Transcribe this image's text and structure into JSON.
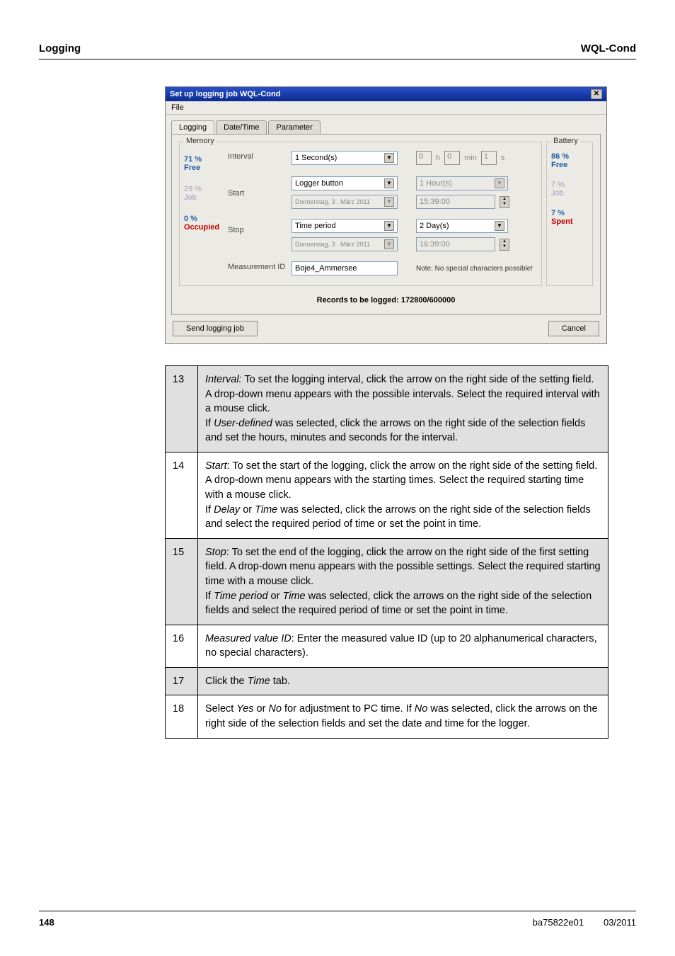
{
  "header": {
    "left": "Logging",
    "right": "WQL-Cond"
  },
  "dialog": {
    "title": "Set up logging job WQL-Cond",
    "menu": {
      "file": "File"
    },
    "tabs": {
      "logging": "Logging",
      "datetime": "Date/Time",
      "parameter": "Parameter"
    },
    "memory": {
      "label": "Memory",
      "pct_free": "71 %",
      "free": "Free",
      "pct_job": "29 %",
      "job": "Job",
      "pct_occ": "0 %",
      "occupied": "Occupied",
      "interval_label": "Interval",
      "interval_value": "1 Second(s)",
      "h0": "0",
      "h": "h",
      "m0": "0",
      "min": "min",
      "s1": "1",
      "s": "s",
      "start_label": "Start",
      "start_value": "Logger button",
      "start_hours": "1 Hour(s)",
      "start_date": "Donnerstag,  3 .  März   2011",
      "start_time": "15:39:00",
      "stop_label": "Stop",
      "stop_value": "Time period",
      "stop_days": "2 Day(s)",
      "stop_date": "Donnerstag,  3 .  März   2011",
      "stop_time": "16:39:00",
      "meas_label": "Measurement ID",
      "meas_value": "Boje4_Ammersee",
      "note": "Note: No special characters possible!"
    },
    "battery": {
      "label": "Battery",
      "pct86": "86 %",
      "free": "Free",
      "pct7a": "7 %",
      "job": "Job",
      "pct7b": "7 %",
      "spent": "Spent"
    },
    "records": "Records to be logged: 172800/600000",
    "send": "Send logging job",
    "cancel": "Cancel"
  },
  "steps": {
    "s13": {
      "n": "13",
      "t": "Interval: To set the logging interval, click the arrow on the right side of the setting field. A drop-down menu appears with the possible intervals. Select the required interval with a mouse click.\nIf User-defined was selected, click the arrows on the right side of the selection fields and set the hours, minutes and seconds for the interval."
    },
    "s14": {
      "n": "14",
      "t": "Start: To set the start of the logging, click the arrow on the right side of the setting field. A drop-down menu appears with the starting times. Select the required starting time with a mouse click.\nIf Delay or Time was selected, click the arrows on the right side of the selection fields and select the required period of time or set the point in time."
    },
    "s15": {
      "n": "15",
      "t": "Stop: To set the end of the logging, click the arrow on the right side of the first setting field. A drop-down menu appears with the possible settings. Select the required starting time with a mouse click.\nIf Time period or Time was selected, click the arrows on the right side of the selection fields and select the required period of time or set the point in time."
    },
    "s16": {
      "n": "16",
      "t": "Measured value ID: Enter the measured value ID (up to 20 alphanumerical characters, no special characters)."
    },
    "s17": {
      "n": "17",
      "t": "Click the Time tab."
    },
    "s18": {
      "n": "18",
      "t": "Select Yes or No for adjustment to PC time. If No was selected, click the arrows on the right side of the selection fields and set the date and time for the logger."
    }
  },
  "footer": {
    "page": "148",
    "doc": "ba75822e01",
    "date": "03/2011"
  }
}
